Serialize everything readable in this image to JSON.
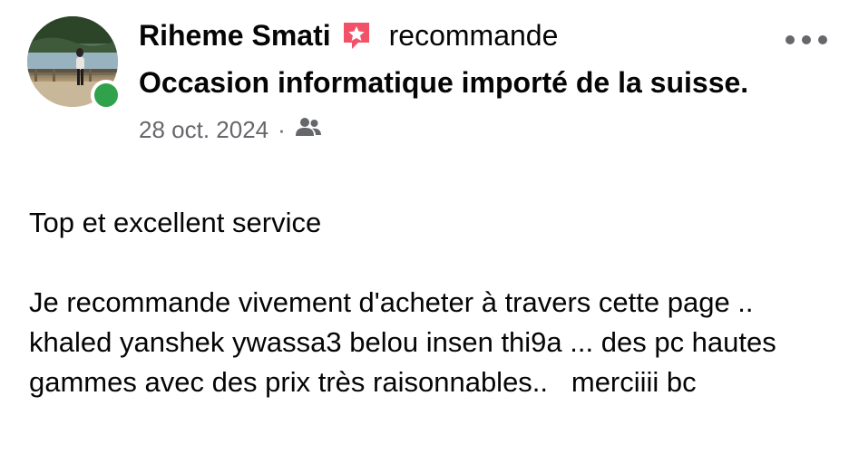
{
  "post": {
    "author_name": "Riheme Smati",
    "recommend_text": "recommande",
    "page_name": "Occasion informatique importé de la suisse.",
    "date": "28 oct. 2024",
    "separator": "·",
    "audience_icon": "friends-icon",
    "body_paragraphs": [
      "Top et excellent service",
      "Je recommande vivement d'acheter à travers cette page .. khaled yanshek ywassa3 belou insen thi9a ... des pc hautes gammes avec des prix très raisonnables..   merciiii bc"
    ]
  },
  "colors": {
    "text": "#050505",
    "secondary_text": "#65676b",
    "online": "#31a24c",
    "recommend_badge": "#f25268"
  }
}
